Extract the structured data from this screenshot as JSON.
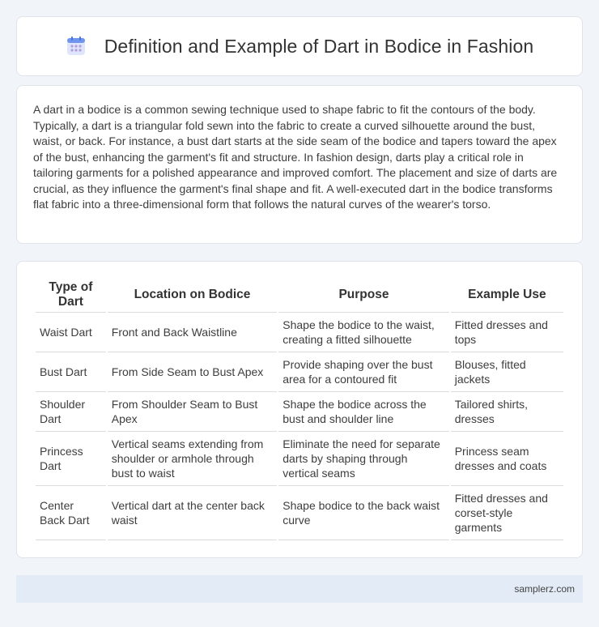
{
  "header": {
    "icon": "calendar-icon",
    "title": "Definition and Example of Dart in Bodice in Fashion"
  },
  "description": "A dart in a bodice is a common sewing technique used to shape fabric to fit the contours of the body. Typically, a dart is a triangular fold sewn into the fabric to create a curved silhouette around the bust, waist, or back. For instance, a bust dart starts at the side seam of the bodice and tapers toward the apex of the bust, enhancing the garment's fit and structure. In fashion design, darts play a critical role in tailoring garments for a polished appearance and improved comfort. The placement and size of darts are crucial, as they influence the garment's final shape and fit. A well-executed dart in the bodice transforms flat fabric into a three-dimensional form that follows the natural curves of the wearer's torso.",
  "table": {
    "headers": [
      "Type of Dart",
      "Location on Bodice",
      "Purpose",
      "Example Use"
    ],
    "rows": [
      [
        "Waist Dart",
        "Front and Back Waistline",
        "Shape the bodice to the waist, creating a fitted silhouette",
        "Fitted dresses and tops"
      ],
      [
        "Bust Dart",
        "From Side Seam to Bust Apex",
        "Provide shaping over the bust area for a contoured fit",
        "Blouses, fitted jackets"
      ],
      [
        "Shoulder Dart",
        "From Shoulder Seam to Bust Apex",
        "Shape the bodice across the bust and shoulder line",
        "Tailored shirts, dresses"
      ],
      [
        "Princess Dart",
        "Vertical seams extending from shoulder or armhole through bust to waist",
        "Eliminate the need for separate darts by shaping through vertical seams",
        "Princess seam dresses and coats"
      ],
      [
        "Center Back Dart",
        "Vertical dart at the center back waist",
        "Shape bodice to the back waist curve",
        "Fitted dresses and corset-style garments"
      ]
    ]
  },
  "footer": {
    "site": "samplerz.com"
  },
  "colors": {
    "background": "#f1f4f8",
    "card": "#ffffff",
    "footer_bg": "#e3ebf6",
    "icon_blue": "#5b8def",
    "icon_purple": "#b39ddb"
  }
}
